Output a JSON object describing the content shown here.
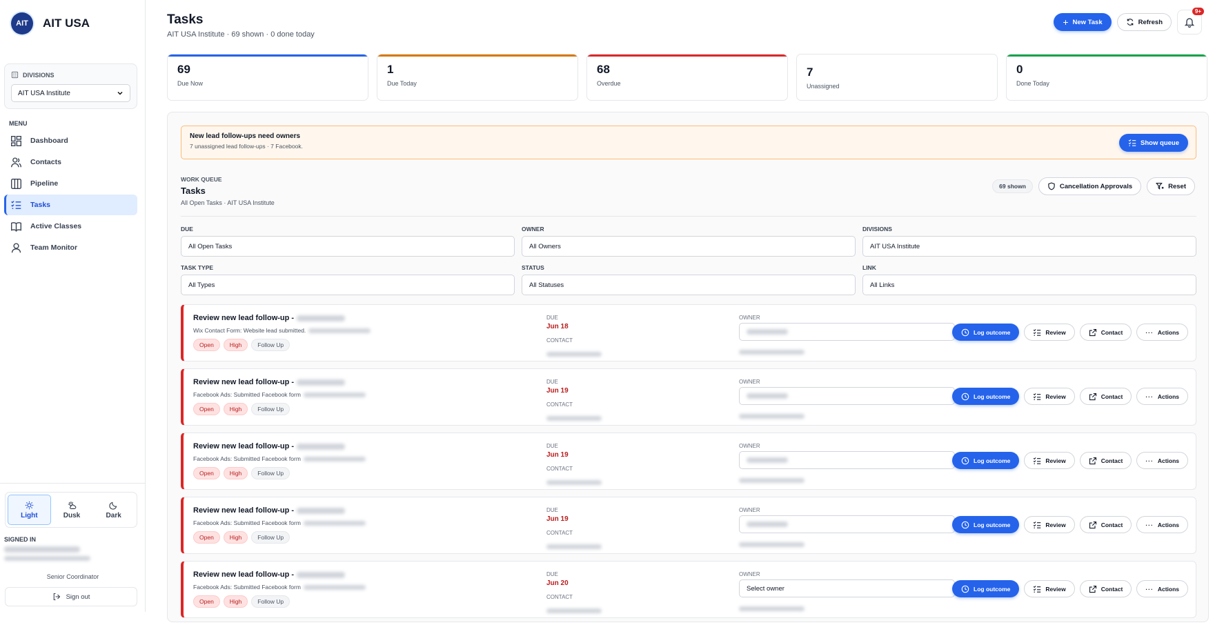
{
  "app": {
    "logo_text": "AIT",
    "name": "AIT USA"
  },
  "sidebar": {
    "divisions_label": "DIVISIONS",
    "division_value": "AIT USA Institute",
    "menu_label": "MENU",
    "items": [
      {
        "label": "Dashboard",
        "icon": "dashboard-icon"
      },
      {
        "label": "Contacts",
        "icon": "contacts-icon"
      },
      {
        "label": "Pipeline",
        "icon": "pipeline-icon"
      },
      {
        "label": "Tasks",
        "icon": "tasks-icon",
        "active": true
      },
      {
        "label": "Active Classes",
        "icon": "book-icon"
      },
      {
        "label": "Team Monitor",
        "icon": "user-icon"
      }
    ],
    "themes": [
      {
        "label": "Light",
        "icon": "sun-icon",
        "active": true
      },
      {
        "label": "Dusk",
        "icon": "cloud-sun-icon"
      },
      {
        "label": "Dark",
        "icon": "moon-icon"
      }
    ],
    "signed_in_label": "SIGNED IN",
    "role": "Senior Coordinator",
    "sign_out": "Sign out"
  },
  "header": {
    "title": "Tasks",
    "subtitle": "AIT USA Institute · 69 shown · 0 done today",
    "new_task": "New Task",
    "refresh": "Refresh",
    "notification_count": "9+"
  },
  "stats": [
    {
      "value": "69",
      "label": "Due Now",
      "color": "#2563eb"
    },
    {
      "value": "1",
      "label": "Due Today",
      "color": "#d97706"
    },
    {
      "value": "68",
      "label": "Overdue",
      "color": "#dc2626"
    },
    {
      "value": "7",
      "label": "Unassigned",
      "color": "#e5e7eb"
    },
    {
      "value": "0",
      "label": "Done Today",
      "color": "#16a34a"
    }
  ],
  "alert": {
    "title": "New lead follow-ups need owners",
    "text": "7 unassigned lead follow-ups · 7 Facebook.",
    "button": "Show queue"
  },
  "work_queue": {
    "label": "WORK QUEUE",
    "title": "Tasks",
    "subtitle": "All Open Tasks · AIT USA Institute",
    "shown": "69 shown",
    "cancellation": "Cancellation Approvals",
    "reset": "Reset"
  },
  "filters": [
    {
      "label": "DUE",
      "value": "All Open Tasks"
    },
    {
      "label": "OWNER",
      "value": "All Owners"
    },
    {
      "label": "DIVISIONS",
      "value": "AIT USA Institute"
    },
    {
      "label": "TASK TYPE",
      "value": "All Types"
    },
    {
      "label": "STATUS",
      "value": "All Statuses"
    },
    {
      "label": "LINK",
      "value": "All Links"
    }
  ],
  "task_labels": {
    "due": "DUE",
    "contact": "CONTACT",
    "owner": "OWNER",
    "log_outcome": "Log outcome",
    "review": "Review",
    "contact_btn": "Contact",
    "actions": "Actions"
  },
  "tasks": [
    {
      "title": "Review new lead follow-up -",
      "desc": "Wix Contact Form: Website lead submitted.",
      "tags": [
        "Open",
        "High",
        "Follow Up"
      ],
      "due": "Jun 18",
      "owner": ""
    },
    {
      "title": "Review new lead follow-up -",
      "desc": "Facebook Ads: Submitted Facebook form",
      "tags": [
        "Open",
        "High",
        "Follow Up"
      ],
      "due": "Jun 19",
      "owner": ""
    },
    {
      "title": "Review new lead follow-up -",
      "desc": "Facebook Ads: Submitted Facebook form",
      "tags": [
        "Open",
        "High",
        "Follow Up"
      ],
      "due": "Jun 19",
      "owner": ""
    },
    {
      "title": "Review new lead follow-up -",
      "desc": "Facebook Ads: Submitted Facebook form",
      "tags": [
        "Open",
        "High",
        "Follow Up"
      ],
      "due": "Jun 19",
      "owner": ""
    },
    {
      "title": "Review new lead follow-up -",
      "desc": "Facebook Ads: Submitted Facebook form",
      "tags": [
        "Open",
        "High",
        "Follow Up"
      ],
      "due": "Jun 20",
      "owner": "Select owner"
    }
  ]
}
